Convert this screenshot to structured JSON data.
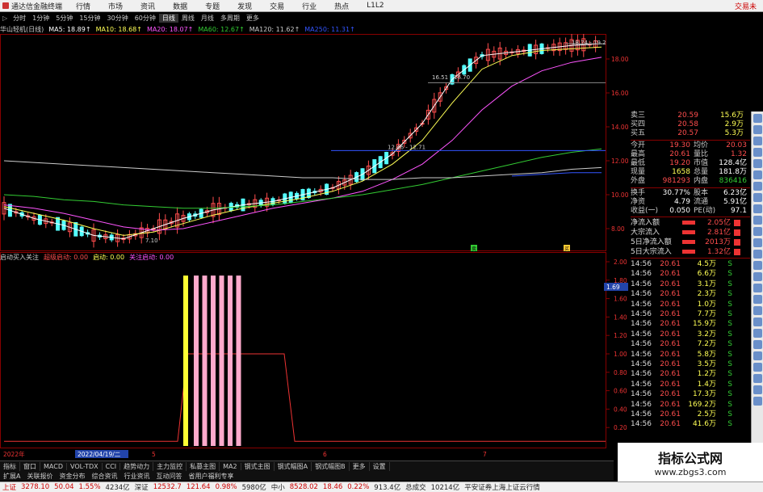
{
  "menubar": {
    "title": "通达信金融终端",
    "items": [
      "行情",
      "市场",
      "资讯",
      "数据",
      "专题",
      "发现",
      "交易",
      "行业",
      "热点",
      "L1L2"
    ],
    "brand": "交易未"
  },
  "periods": {
    "first": "▷",
    "items": [
      "分时",
      "1分钟",
      "5分钟",
      "15分钟",
      "30分钟",
      "60分钟",
      "日线",
      "周线",
      "月线",
      "多周期",
      "更多"
    ],
    "active_index": 6
  },
  "ma_legend": [
    {
      "text": "华山轻机(日线)",
      "color": "#cccccc"
    },
    {
      "text": "MA5: 18.89↑",
      "color": "#ffffff"
    },
    {
      "text": "MA10: 18.68↑",
      "color": "#ffff55"
    },
    {
      "text": "MA20: 18.07↑",
      "color": "#ff55ff"
    },
    {
      "text": "MA60: 12.67↑",
      "color": "#33cc33"
    },
    {
      "text": "MA120: 11.62↑",
      "color": "#cccccc"
    },
    {
      "text": "MA250: 11.31↑",
      "color": "#3355ff"
    }
  ],
  "main_axis": [
    "18.00",
    "16.00",
    "14.00",
    "12.00",
    "10.00",
    "8.00"
  ],
  "sub_axis": [
    "2.00",
    "1.80",
    "1.60",
    "1.40",
    "1.20",
    "1.00",
    "0.80",
    "0.60",
    "0.40",
    "0.20"
  ],
  "annotations": {
    "price_high": "18.74 - 19.2",
    "price_mid": "16.51 - 16.70",
    "price_low": "12.46 - 12.71",
    "price_bottom": "7.10",
    "price_bar_value": "1.69",
    "sell_marker": "卖",
    "buy_marker": "买"
  },
  "sub_legend": [
    {
      "text": "启动买入关注",
      "color": "#cccccc"
    },
    {
      "text": "超级启动: 0.00",
      "color": "#ff4d4d"
    },
    {
      "text": "启动: 0.00",
      "color": "#ffff55"
    },
    {
      "text": "关注启动: 0.00",
      "color": "#ff55ff"
    }
  ],
  "date_axis": {
    "left": "2022年",
    "highlight": "2022/04/19/二",
    "m1": "5",
    "m2": "6",
    "m3": "7"
  },
  "quote": {
    "asks": [
      {
        "label": "卖三",
        "price": "20.59",
        "vol": "15.6万"
      },
      {
        "label": "买四",
        "price": "20.58",
        "vol": "2.9万"
      },
      {
        "label": "买五",
        "price": "20.57",
        "vol": "5.3万"
      }
    ],
    "stats": [
      {
        "l": "今开",
        "v": "19.30",
        "vc": "red",
        "l2": "均价",
        "v2": "20.03",
        "v2c": "red"
      },
      {
        "l": "最高",
        "v": "20.61",
        "vc": "red",
        "l2": "量比",
        "v2": "1.32",
        "v2c": "red"
      },
      {
        "l": "最低",
        "v": "19.20",
        "vc": "red",
        "l2": "市值",
        "v2": "128.4亿",
        "v2c": "white"
      },
      {
        "l": "现量",
        "v": "1658",
        "vc": "yellow",
        "l2": "总量",
        "v2": "181.8万",
        "v2c": "white"
      },
      {
        "l": "外盘",
        "v": "981293",
        "vc": "red",
        "l2": "内盘",
        "v2": "836416",
        "v2c": "green"
      }
    ],
    "stats2": [
      {
        "l": "换手",
        "v": "30.77%",
        "vc": "white",
        "l2": "股本",
        "v2": "6.23亿",
        "v2c": "white"
      },
      {
        "l": "净资",
        "v": "4.79",
        "vc": "white",
        "l2": "流通",
        "v2": "5.91亿",
        "v2c": "white"
      },
      {
        "l": "收益(一)",
        "v": "0.050",
        "vc": "white",
        "l2": "PE(动)",
        "v2": "97.1",
        "v2c": "white"
      }
    ],
    "flows": [
      {
        "label": "净流入额",
        "value": "2.05亿"
      },
      {
        "label": "大宗流入",
        "value": "2.81亿"
      },
      {
        "label": "5日净流入额",
        "value": "2013万"
      },
      {
        "label": "5日大宗流入",
        "value": "1.32亿"
      }
    ],
    "ticks": [
      {
        "t": "14:56",
        "p": "20.61",
        "q": "4.5万",
        "s": "S"
      },
      {
        "t": "14:56",
        "p": "20.61",
        "q": "6.6万",
        "s": "S"
      },
      {
        "t": "14:56",
        "p": "20.61",
        "q": "3.1万",
        "s": "S"
      },
      {
        "t": "14:56",
        "p": "20.61",
        "q": "2.3万",
        "s": "S"
      },
      {
        "t": "14:56",
        "p": "20.61",
        "q": "1.0万",
        "s": "S"
      },
      {
        "t": "14:56",
        "p": "20.61",
        "q": "7.7万",
        "s": "S"
      },
      {
        "t": "14:56",
        "p": "20.61",
        "q": "15.9万",
        "s": "S"
      },
      {
        "t": "14:56",
        "p": "20.61",
        "q": "3.2万",
        "s": "S"
      },
      {
        "t": "14:56",
        "p": "20.61",
        "q": "7.2万",
        "s": "S"
      },
      {
        "t": "14:56",
        "p": "20.61",
        "q": "5.8万",
        "s": "S"
      },
      {
        "t": "14:56",
        "p": "20.61",
        "q": "3.5万",
        "s": "S"
      },
      {
        "t": "14:56",
        "p": "20.61",
        "q": "1.2万",
        "s": "S"
      },
      {
        "t": "14:56",
        "p": "20.61",
        "q": "1.4万",
        "s": "S"
      },
      {
        "t": "14:56",
        "p": "20.61",
        "q": "17.3万",
        "s": "S"
      },
      {
        "t": "14:56",
        "p": "20.61",
        "q": "169.2万",
        "s": "S"
      },
      {
        "t": "14:56",
        "p": "20.61",
        "q": "2.5万",
        "s": "S"
      },
      {
        "t": "14:56",
        "p": "20.61",
        "q": "41.6万",
        "s": "S"
      }
    ]
  },
  "tabs": [
    "指标",
    "窗口",
    "MACD",
    "VOL-TDX",
    "CCI",
    "趋势动力",
    "主力监控",
    "私募主图",
    "MA2",
    "钢式主图",
    "钢式幅图A",
    "钢式幅图B",
    "更多",
    "设置"
  ],
  "subtabs": [
    "扩展A",
    "关联报价",
    "资金分布",
    "综合资讯",
    "行业资讯",
    "互动问答",
    "省用户福利专享"
  ],
  "status": {
    "sh_label": "上证",
    "sh_price": "3278.10",
    "sh_chg": "50.04",
    "sh_pct": "1.55%",
    "sh_amt": "4234亿",
    "sz_label": "深证",
    "sz_price": "12532.7",
    "sz_chg": "121.64",
    "sz_pct": "0.98%",
    "sz_amt": "5980亿",
    "zx_label": "中小",
    "zx_price": "8528.02",
    "zx_chg": "18.46",
    "zx_pct": "0.22%",
    "zx_amt": "913.4亿",
    "total_label": "总成交",
    "total_amt": "10214亿",
    "broker": "平安证券上海上证云行情"
  },
  "watermark": {
    "line1": "指标公式网",
    "line2": "www.zbgs3.com"
  },
  "chart_data": [
    {
      "type": "line",
      "title": "华山轻机(日线)",
      "x": [
        0,
        5,
        10,
        15,
        20,
        25,
        30,
        35,
        40,
        45,
        50,
        55,
        60,
        65,
        70,
        75,
        80,
        85,
        90,
        95,
        100
      ],
      "series": [
        {
          "name": "MA5",
          "values": [
            9.2,
            8.6,
            8.2,
            7.6,
            7.4,
            8.0,
            8.6,
            9.1,
            9.4,
            9.6,
            10.0,
            10.4,
            11.2,
            12.4,
            14.2,
            16.8,
            18.2,
            18.4,
            18.6,
            18.8,
            18.9
          ]
        },
        {
          "name": "MA10",
          "values": [
            9.3,
            8.9,
            8.5,
            8.0,
            7.6,
            7.8,
            8.3,
            8.8,
            9.2,
            9.5,
            9.8,
            10.2,
            10.8,
            11.8,
            13.2,
            15.4,
            17.4,
            18.2,
            18.5,
            18.6,
            18.7
          ]
        },
        {
          "name": "MA20",
          "values": [
            9.4,
            9.2,
            8.9,
            8.5,
            8.1,
            7.9,
            8.0,
            8.4,
            8.8,
            9.2,
            9.5,
            9.8,
            10.2,
            10.9,
            11.8,
            13.2,
            15.0,
            16.4,
            17.3,
            17.8,
            18.1
          ]
        },
        {
          "name": "MA60",
          "values": [
            10.0,
            9.9,
            9.7,
            9.6,
            9.4,
            9.3,
            9.2,
            9.2,
            9.3,
            9.4,
            9.6,
            9.8,
            10.0,
            10.3,
            10.6,
            11.0,
            11.4,
            11.8,
            12.2,
            12.5,
            12.7
          ]
        },
        {
          "name": "MA120",
          "values": [
            12.0,
            11.9,
            11.8,
            11.7,
            11.6,
            11.5,
            11.4,
            11.3,
            11.2,
            11.1,
            11.0,
            11.0,
            10.9,
            10.9,
            11.0,
            11.0,
            11.1,
            11.2,
            11.3,
            11.5,
            11.6
          ]
        },
        {
          "name": "MA250",
          "values": [
            null,
            null,
            null,
            null,
            null,
            null,
            null,
            null,
            null,
            null,
            null,
            null,
            null,
            null,
            null,
            null,
            null,
            11.1,
            11.2,
            11.3,
            11.3
          ]
        }
      ],
      "ylim": [
        7,
        19
      ]
    },
    {
      "type": "bar",
      "title": "启动买入关注",
      "series": [
        {
          "name": "启动",
          "values": [
            1.85
          ]
        },
        {
          "name": "关注启动",
          "values": [
            1.85,
            1.85,
            1.85,
            1.85,
            1.85,
            1.85
          ]
        },
        {
          "name": "超级启动",
          "values": [
            0.0,
            0.0,
            1.0,
            1.0,
            1.0,
            0.0
          ]
        }
      ],
      "ylim": [
        0,
        2.0
      ]
    }
  ]
}
